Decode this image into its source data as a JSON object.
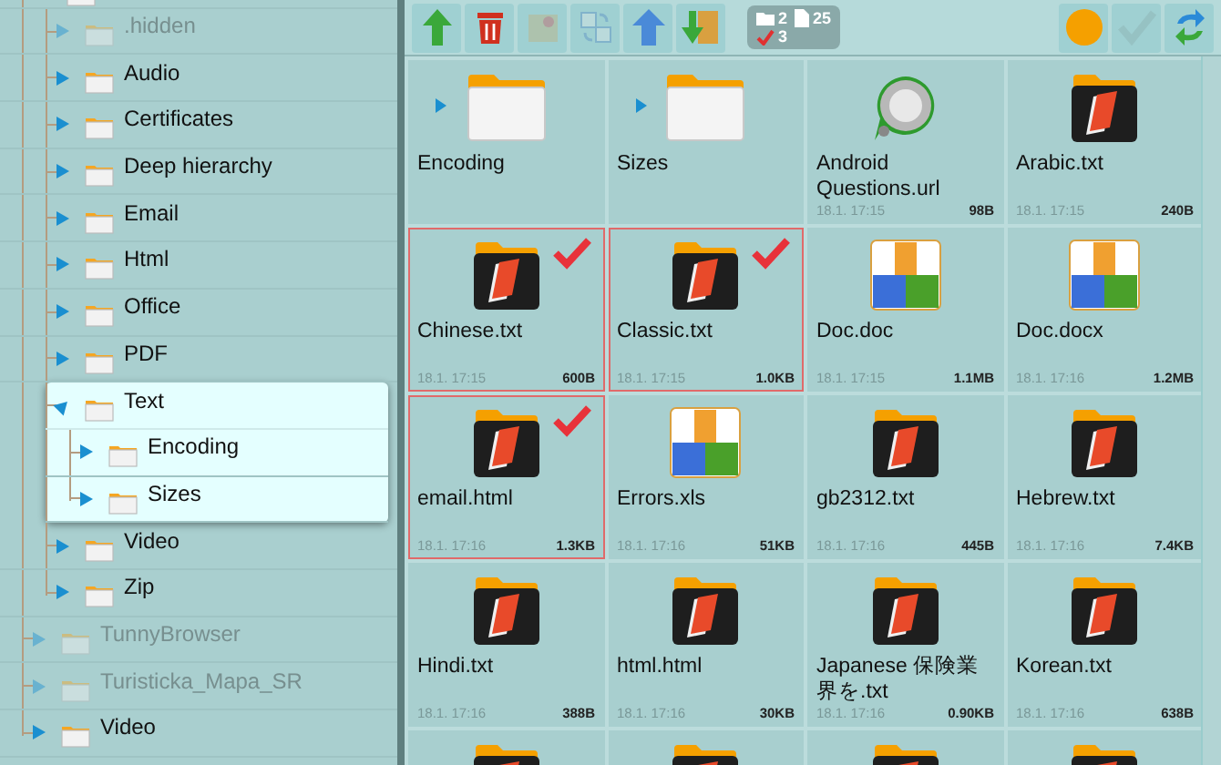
{
  "tree": [
    {
      "expanded": true,
      "children": [
        {
          "label": ".hidden",
          "dimmed": true,
          "expanded": false,
          "highlighted": false
        },
        {
          "label": "Audio",
          "dimmed": false,
          "expanded": false,
          "highlighted": false
        },
        {
          "label": "Certificates",
          "dimmed": false,
          "expanded": false,
          "highlighted": false
        },
        {
          "label": "Deep hierarchy",
          "dimmed": false,
          "expanded": false,
          "highlighted": false
        },
        {
          "label": "Email",
          "dimmed": false,
          "expanded": false,
          "highlighted": false
        },
        {
          "label": "Html",
          "dimmed": false,
          "expanded": false,
          "highlighted": false
        },
        {
          "label": "Office",
          "dimmed": false,
          "expanded": false,
          "highlighted": false
        },
        {
          "label": "PDF",
          "dimmed": false,
          "expanded": false,
          "highlighted": false
        },
        {
          "label": "Text",
          "dimmed": false,
          "expanded": true,
          "highlighted": true,
          "children": [
            {
              "label": "Encoding",
              "dimmed": false,
              "expanded": false,
              "highlighted": false
            },
            {
              "label": "Sizes",
              "dimmed": false,
              "expanded": false,
              "highlighted": false
            }
          ]
        },
        {
          "label": "Video",
          "dimmed": false,
          "expanded": false,
          "highlighted": false
        },
        {
          "label": "Zip",
          "dimmed": false,
          "expanded": false,
          "highlighted": false
        }
      ]
    },
    {
      "label": "TunnyBrowser",
      "dimmed": true,
      "expanded": false,
      "highlighted": false
    },
    {
      "label": "Turisticka_Mapa_SR",
      "dimmed": true,
      "expanded": false,
      "highlighted": false
    },
    {
      "label": "Video",
      "dimmed": false,
      "expanded": false,
      "highlighted": false
    }
  ],
  "toolbar": {
    "left": [
      {
        "kind": "up-green",
        "disabled": false
      },
      {
        "kind": "trash",
        "disabled": false
      },
      {
        "kind": "package",
        "disabled": true
      },
      {
        "kind": "rename",
        "disabled": true
      },
      {
        "kind": "up-blue",
        "disabled": false
      },
      {
        "kind": "download",
        "disabled": false
      }
    ],
    "summary": {
      "folders": "2",
      "files": "25",
      "checked": "3"
    },
    "right": [
      {
        "kind": "circle",
        "disabled": false
      },
      {
        "kind": "check",
        "disabled": true
      },
      {
        "kind": "refresh",
        "disabled": false
      }
    ]
  },
  "files": [
    {
      "kind": "folder",
      "name": "Encoding",
      "checked": false
    },
    {
      "kind": "folder",
      "name": "Sizes",
      "checked": false
    },
    {
      "kind": "link",
      "name": "Android Questions.url",
      "date": "18.1. 17:15",
      "size": "98B",
      "checked": false
    },
    {
      "kind": "text",
      "name": "Arabic.txt",
      "date": "18.1. 17:15",
      "size": "240B",
      "checked": false
    },
    {
      "kind": "text",
      "name": "Chinese.txt",
      "date": "18.1. 17:15",
      "size": "600B",
      "checked": true
    },
    {
      "kind": "text",
      "name": "Classic.txt",
      "date": "18.1. 17:15",
      "size": "1.0KB",
      "checked": true
    },
    {
      "kind": "office",
      "name": "Doc.doc",
      "date": "18.1. 17:15",
      "size": "1.1MB",
      "checked": false
    },
    {
      "kind": "office",
      "name": "Doc.docx",
      "date": "18.1. 17:16",
      "size": "1.2MB",
      "checked": false
    },
    {
      "kind": "text",
      "name": "email.html",
      "date": "18.1. 17:16",
      "size": "1.3KB",
      "checked": true
    },
    {
      "kind": "office",
      "name": "Errors.xls",
      "date": "18.1. 17:16",
      "size": "51KB",
      "checked": false
    },
    {
      "kind": "text",
      "name": "gb2312.txt",
      "date": "18.1. 17:16",
      "size": "445B",
      "checked": false
    },
    {
      "kind": "text",
      "name": "Hebrew.txt",
      "date": "18.1. 17:16",
      "size": "7.4KB",
      "checked": false
    },
    {
      "kind": "text",
      "name": "Hindi.txt",
      "date": "18.1. 17:16",
      "size": "388B",
      "checked": false
    },
    {
      "kind": "text",
      "name": "html.html",
      "date": "18.1. 17:16",
      "size": "30KB",
      "checked": false
    },
    {
      "kind": "text",
      "name": "Japanese 保険業界を.txt",
      "date": "18.1. 17:16",
      "size": "0.90KB",
      "checked": false
    },
    {
      "kind": "text",
      "name": "Korean.txt",
      "date": "18.1. 17:16",
      "size": "638B",
      "checked": false
    },
    {
      "kind": "text",
      "checked": false
    },
    {
      "kind": "text",
      "checked": false
    },
    {
      "kind": "text",
      "checked": false
    },
    {
      "kind": "text",
      "checked": false
    }
  ]
}
